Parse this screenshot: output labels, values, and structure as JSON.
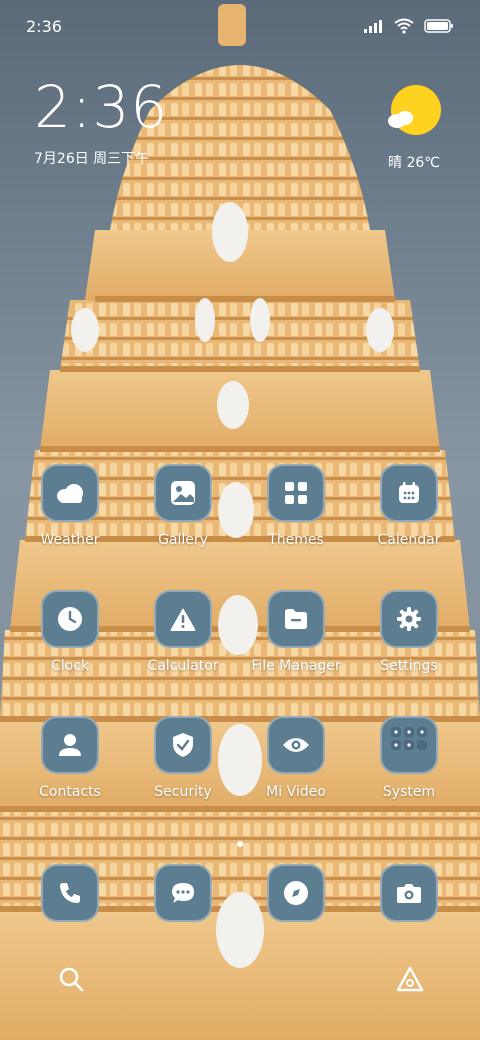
{
  "status": {
    "time": "2:36"
  },
  "clock": {
    "time": "2:36",
    "date": "7月26日 周三下午"
  },
  "weather": {
    "label": "晴 26℃"
  },
  "apps": [
    {
      "label": "Weather",
      "icon": "weather-icon"
    },
    {
      "label": "Gallery",
      "icon": "gallery-icon"
    },
    {
      "label": "Themes",
      "icon": "themes-icon"
    },
    {
      "label": "Calendar",
      "icon": "calendar-icon"
    },
    {
      "label": "Clock",
      "icon": "clock-icon"
    },
    {
      "label": "Calculator",
      "icon": "calculator-icon"
    },
    {
      "label": "File Manager",
      "icon": "file-manager-icon"
    },
    {
      "label": "Settings",
      "icon": "settings-icon"
    },
    {
      "label": "Contacts",
      "icon": "contacts-icon"
    },
    {
      "label": "Security",
      "icon": "security-icon"
    },
    {
      "label": "Mi Video",
      "icon": "video-icon"
    },
    {
      "label": "System",
      "icon": "folder-icon"
    }
  ],
  "dock": [
    {
      "icon": "phone-icon"
    },
    {
      "icon": "messages-icon"
    },
    {
      "icon": "browser-icon"
    },
    {
      "icon": "camera-icon"
    }
  ],
  "bottom": {
    "left": "search-icon",
    "right": "assistant-icon"
  },
  "colors": {
    "tile": "#5d7d90",
    "sun": "#ffd21f",
    "stone": "#e7b97a"
  }
}
